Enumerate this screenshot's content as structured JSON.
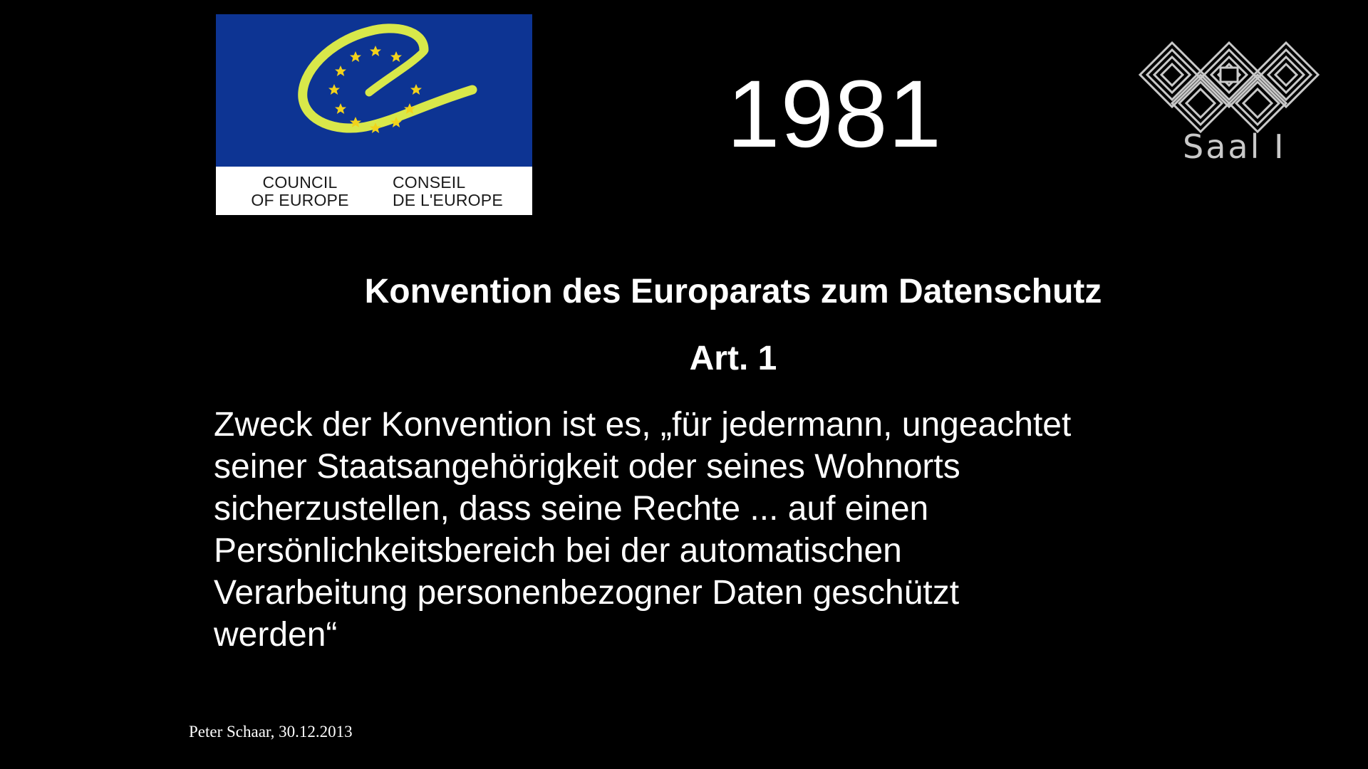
{
  "logo": {
    "caption_en_line1": "COUNCIL",
    "caption_en_line2": "OF EUROPE",
    "caption_fr_line1": "CONSEIL",
    "caption_fr_line2": "DE L'EUROPE",
    "flag_color": "#0d3493",
    "arc_color": "#d8e84a",
    "star_color": "#f2d21b"
  },
  "year": "1981",
  "event_logo": {
    "label": "Saal I",
    "color": "#c9c9c9"
  },
  "title": "Konvention des Europarats zum Datenschutz",
  "article": "Art. 1",
  "body_lines": [
    "Zweck der Konvention ist es, „für jedermann, ungeachtet",
    "seiner Staatsangehörigkeit oder seines Wohnorts",
    "sicherzustellen, dass seine Rechte ... auf einen",
    "Persönlichkeitsbereich bei der automatischen",
    "Verarbeitung personenbezogner Daten geschützt",
    "werden“"
  ],
  "footer": "Peter Schaar, 30.12.2013"
}
